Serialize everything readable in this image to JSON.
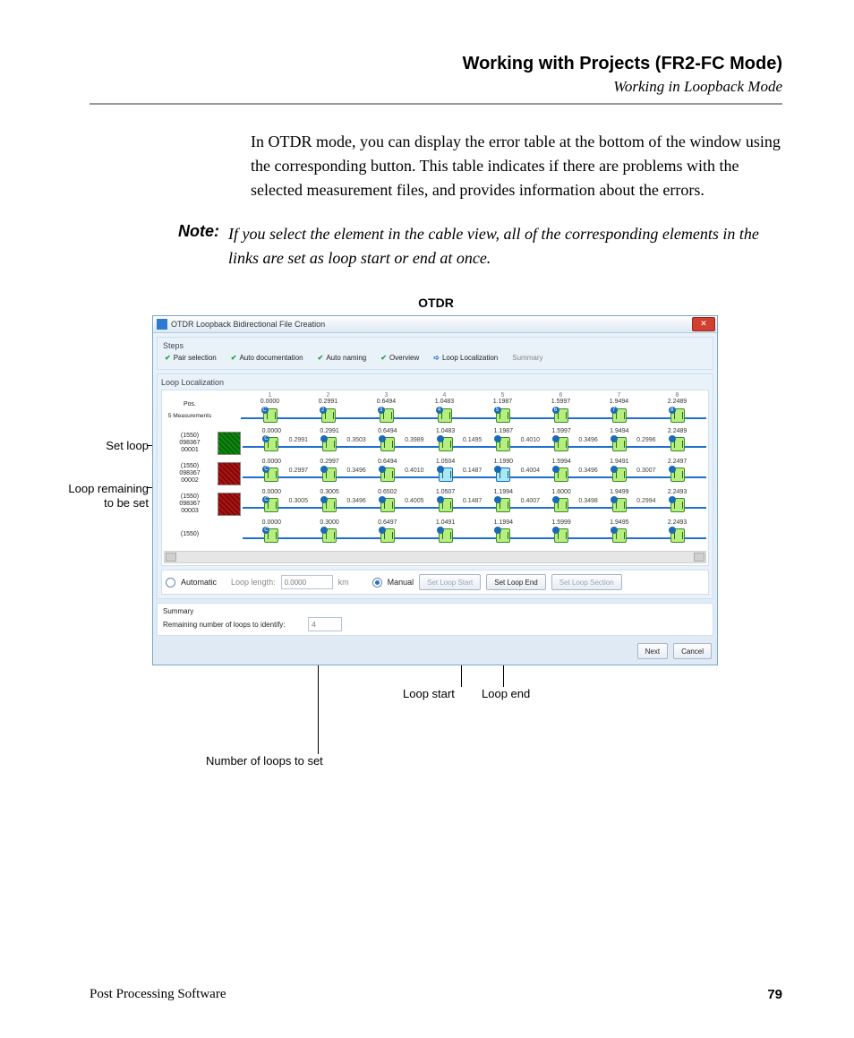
{
  "header": {
    "title": "Working with Projects (FR2-FC Mode)",
    "subtitle": "Working in Loopback Mode"
  },
  "body": {
    "para1": "In OTDR mode, you can display the error table at the bottom of the window using the corresponding button. This table indicates if there are problems with the selected measurement files, and provides information about the errors.",
    "note_label": "Note:",
    "note_text": "If you select the element in the cable view, all of the corresponding elements in the links are set as loop start or end at once."
  },
  "figure": {
    "caption": "OTDR",
    "labels": {
      "set_loop": "Set loop",
      "loop_remaining": "Loop remaining to be set",
      "loop_start": "Loop start",
      "loop_end": "Loop end",
      "num_loops": "Number of loops to set"
    },
    "window": {
      "title": "OTDR Loopback Bidirectional File Creation",
      "steps_heading": "Steps",
      "steps": [
        "Pair selection",
        "Auto documentation",
        "Auto naming",
        "Overview",
        "Loop Localization",
        "Summary"
      ],
      "loop_loc_heading": "Loop Localization",
      "col_headers": [
        "1",
        "2",
        "3",
        "4",
        "5",
        "6",
        "7",
        "8"
      ],
      "pos_label": "Pos.",
      "meas_label": "5 Measurements",
      "top_values": [
        "0.0000",
        "0.2991",
        "0.6494",
        "1.0483",
        "1.1987",
        "1.5997",
        "1.9494",
        "2.2489"
      ],
      "rows": [
        {
          "id": "(1550)\n098367\n00001",
          "thumb": "green",
          "top": [
            "0.0000",
            "0.2991",
            "0.6494",
            "1.0483",
            "1.1987",
            "1.5997",
            "1.9494",
            "2.2489"
          ],
          "mid": [
            "0.2991",
            "0.3503",
            "0.3989",
            "0.1495",
            "0.4010",
            "0.3496",
            "0.2996",
            ""
          ]
        },
        {
          "id": "(1550)\n098367\n00002",
          "thumb": "red",
          "top": [
            "0.0000",
            "0.2997",
            "0.6494",
            "1.0504",
            "1.1990",
            "1.5994",
            "1.9491",
            "2.2497"
          ],
          "mid": [
            "0.2997",
            "0.3496",
            "0.4010",
            "0.1487",
            "0.4004",
            "0.3496",
            "0.3007",
            ""
          ]
        },
        {
          "id": "(1550)\n098367\n00003",
          "thumb": "red",
          "top": [
            "0.0000",
            "0.3005",
            "0.6502",
            "1.0507",
            "1.1994",
            "1.6000",
            "1.9499",
            "2.2493"
          ],
          "mid": [
            "0.3005",
            "0.3496",
            "0.4005",
            "0.1487",
            "0.4007",
            "0.3498",
            "0.2994",
            ""
          ]
        },
        {
          "id": "(1550)",
          "thumb": "",
          "top": [
            "0.0000",
            "0.3000",
            "0.6497",
            "1.0491",
            "1.1994",
            "1.5999",
            "1.9495",
            "2.2493"
          ],
          "mid": [
            "",
            "",
            "",
            "",
            "",
            "",
            "",
            ""
          ]
        }
      ],
      "controls": {
        "automatic": "Automatic",
        "loop_length_label": "Loop length:",
        "loop_length_value": "0.0000",
        "loop_length_unit": "km",
        "manual": "Manual",
        "set_loop_start": "Set Loop Start",
        "set_loop_end": "Set Loop End",
        "set_loop_section": "Set Loop Section"
      },
      "summary": {
        "heading": "Summary",
        "label": "Remaining number of loops to identify:",
        "value": "4"
      },
      "buttons": {
        "next": "Next",
        "cancel": "Cancel"
      }
    }
  },
  "footer": {
    "left": "Post Processing Software",
    "page": "79"
  }
}
